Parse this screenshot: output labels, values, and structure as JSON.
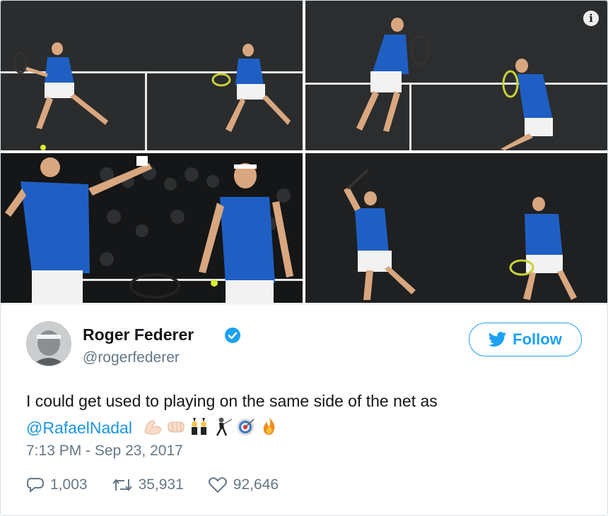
{
  "media": {
    "info_icon": "info-icon",
    "photos": [
      {
        "name": "photo-1"
      },
      {
        "name": "photo-2"
      },
      {
        "name": "photo-3"
      },
      {
        "name": "photo-4"
      }
    ]
  },
  "author": {
    "name": "Roger Federer",
    "handle": "@rogerfederer",
    "verified": true
  },
  "follow": {
    "label": "Follow"
  },
  "tweet": {
    "text": "I could get used to playing on the same side of the net as",
    "mention": "@RafaelNadal",
    "emojis": [
      "flexed-biceps",
      "fist-bump",
      "people-with-bunny-ears",
      "fencer",
      "direct-hit",
      "fire"
    ]
  },
  "timestamp": "7:13 PM - Sep 23, 2017",
  "stats": {
    "replies": "1,003",
    "retweets": "35,931",
    "likes": "92,646"
  },
  "colors": {
    "link": "#1b95e0",
    "follow_border": "#1da1f2",
    "muted": "#657786",
    "court": "#262829",
    "shirt": "#1f5fc4"
  }
}
